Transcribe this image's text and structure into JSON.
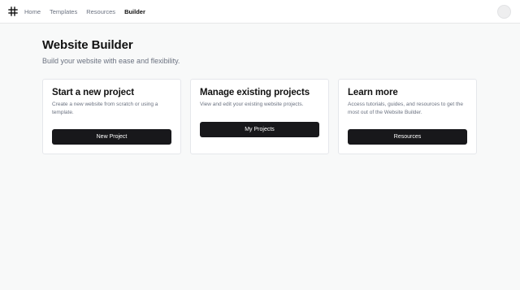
{
  "nav": {
    "logo_icon": "command-icon",
    "items": [
      {
        "label": "Home",
        "active": false
      },
      {
        "label": "Templates",
        "active": false
      },
      {
        "label": "Resources",
        "active": false
      },
      {
        "label": "Builder",
        "active": true
      }
    ]
  },
  "page": {
    "title": "Website Builder",
    "subtitle": "Build your website with ease and flexibility."
  },
  "cards": [
    {
      "title": "Start a new project",
      "description": "Create a new website from scratch or using a template.",
      "button_label": "New Project"
    },
    {
      "title": "Manage existing projects",
      "description": "View and edit your existing website projects.",
      "button_label": "My Projects"
    },
    {
      "title": "Learn more",
      "description": "Access tutorials, guides, and resources to get the most out of the Website Builder.",
      "button_label": "Resources"
    }
  ],
  "colors": {
    "background": "#f8f9f9",
    "button": "#18181b",
    "muted_text": "#6b7280"
  }
}
